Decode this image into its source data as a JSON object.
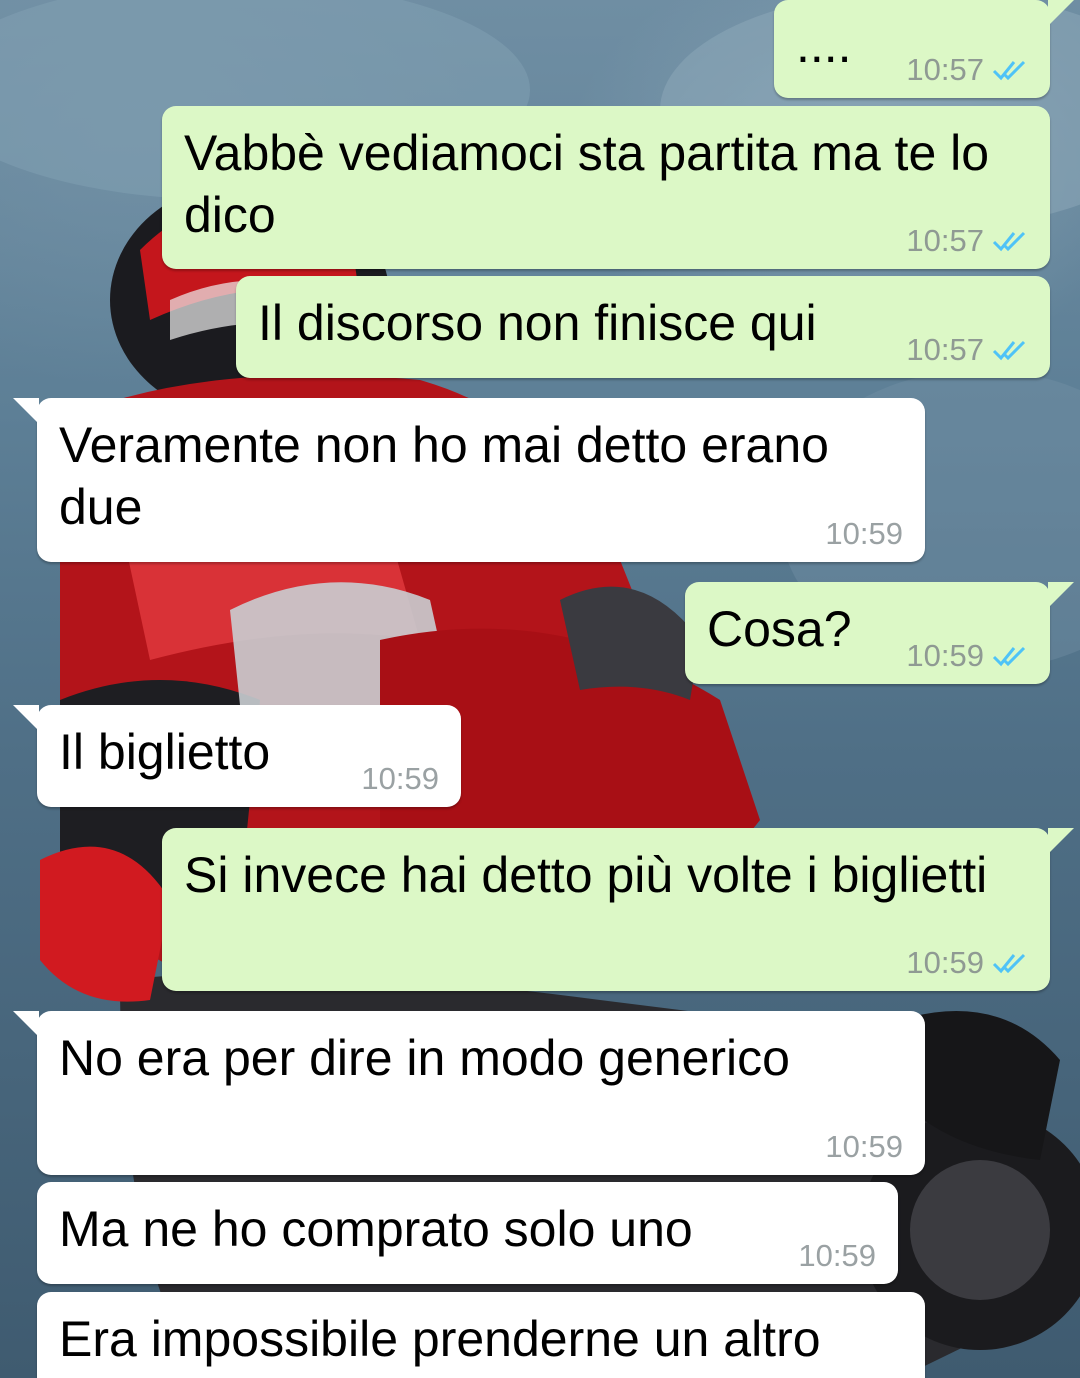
{
  "colors": {
    "outgoing_bubble": "#dcf8c6",
    "incoming_bubble": "#ffffff",
    "read_ticks": "#4fc3f7",
    "timestamp": "#8f9a93"
  },
  "wallpaper": {
    "icon": "motorcycle-rider-image"
  },
  "messages": [
    {
      "direction": "out",
      "lines": [
        "...."
      ],
      "time": "10:57",
      "status": "read"
    },
    {
      "direction": "out",
      "lines": [
        "Vabbè vediamoci sta partita ma te lo",
        "dico"
      ],
      "time": "10:57",
      "status": "read"
    },
    {
      "direction": "out",
      "lines": [
        "Il discorso non finisce qui"
      ],
      "time": "10:57",
      "status": "read"
    },
    {
      "direction": "in",
      "lines": [
        "Veramente non ho mai detto erano",
        "due"
      ],
      "time": "10:59"
    },
    {
      "direction": "out",
      "lines": [
        "Cosa?"
      ],
      "time": "10:59",
      "status": "read"
    },
    {
      "direction": "in",
      "lines": [
        "Il biglietto"
      ],
      "time": "10:59"
    },
    {
      "direction": "out",
      "lines": [
        "Si invece hai detto più volte i biglietti"
      ],
      "time": "10:59",
      "status": "read"
    },
    {
      "direction": "in",
      "lines": [
        "No era per dire in modo generico"
      ],
      "time": "10:59"
    },
    {
      "direction": "in",
      "lines": [
        "Ma ne ho comprato solo uno"
      ],
      "time": "10:59"
    },
    {
      "direction": "in",
      "lines": [
        "Era impossibile prenderne un altro"
      ],
      "time": ""
    }
  ]
}
